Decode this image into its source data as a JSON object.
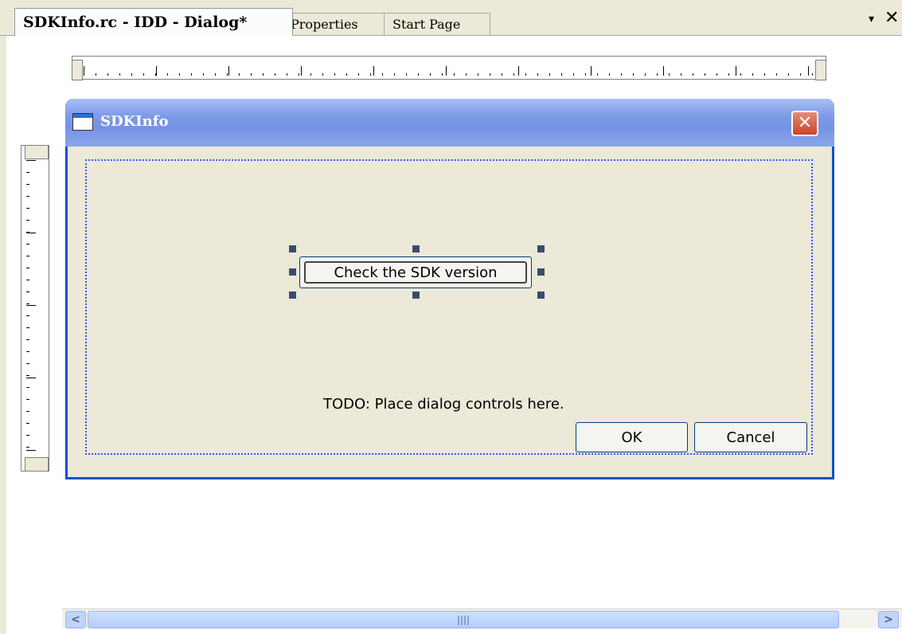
{
  "tabs": [
    {
      "label": "SDKInfo.rc - IDD - Dialog*",
      "active": true
    },
    {
      "label": "Properties",
      "active": false
    },
    {
      "label": "Start Page",
      "active": false
    }
  ],
  "tab_controls": {
    "dropdown_icon": "chevron-down-icon",
    "close_icon": "close-icon",
    "chevron": "▾",
    "close": "✕"
  },
  "dialog": {
    "title": "SDKInfo",
    "close_glyph": "✕",
    "check_button_label": "Check the SDK version",
    "todo_text": "TODO: Place dialog controls here.",
    "ok_label": "OK",
    "cancel_label": "Cancel"
  },
  "scrollbar": {
    "left_glyph": "<",
    "right_glyph": ">"
  },
  "colors": {
    "title_bar": "#7e9be8",
    "dialog_border": "#0a50c9",
    "close_button": "#c8452c",
    "selection_handles": "#3c4a6e",
    "dotted_guide": "#3355ff"
  }
}
